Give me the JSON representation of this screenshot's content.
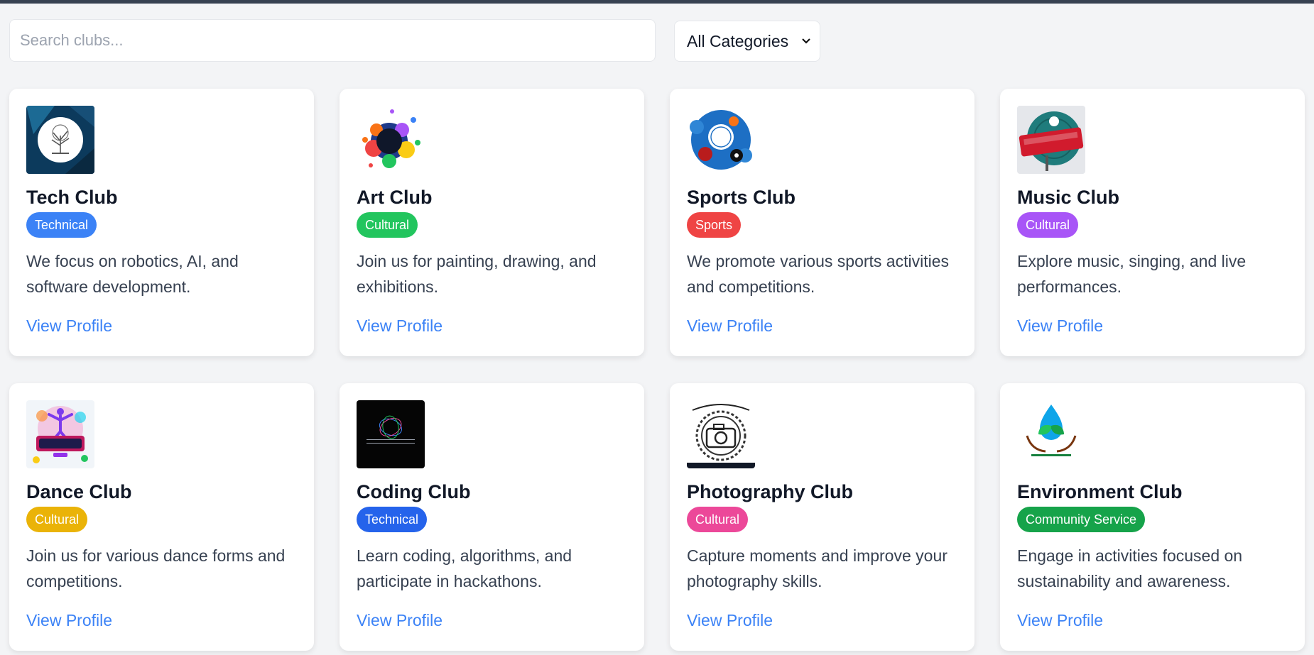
{
  "search": {
    "placeholder": "Search clubs..."
  },
  "filter": {
    "selected": "All Categories"
  },
  "clubs": [
    {
      "name": "Tech Club",
      "category": "Technical",
      "badge_color": "#3b82f6",
      "description": "We focus on robotics, AI, and software development.",
      "link": "View Profile",
      "logo_icon": "tree-icon"
    },
    {
      "name": "Art Club",
      "category": "Cultural",
      "badge_color": "#22c55e",
      "description": "Join us for painting, drawing, and exhibitions.",
      "link": "View Profile",
      "logo_icon": "paint-splash-icon"
    },
    {
      "name": "Sports Club",
      "category": "Sports",
      "badge_color": "#ef4444",
      "description": "We promote various sports activities and competitions.",
      "link": "View Profile",
      "logo_icon": "sports-ball-icon"
    },
    {
      "name": "Music Club",
      "category": "Cultural",
      "badge_color": "#a855f7",
      "description": "Explore music, singing, and live performances.",
      "link": "View Profile",
      "logo_icon": "music-record-icon"
    },
    {
      "name": "Dance Club",
      "category": "Cultural",
      "badge_color": "#eab308",
      "description": "Join us for various dance forms and competitions.",
      "link": "View Profile",
      "logo_icon": "dancer-icon"
    },
    {
      "name": "Coding Club",
      "category": "Technical",
      "badge_color": "#2563eb",
      "description": "Learn coding, algorithms, and participate in hackathons.",
      "link": "View Profile",
      "logo_icon": "code-icon"
    },
    {
      "name": "Photography Club",
      "category": "Cultural",
      "badge_color": "#ec4899",
      "description": "Capture moments and improve your photography skills.",
      "link": "View Profile",
      "logo_icon": "camera-icon"
    },
    {
      "name": "Environment Club",
      "category": "Community Service",
      "badge_color": "#16a34a",
      "description": "Engage in activities focused on sustainability and awareness.",
      "link": "View Profile",
      "logo_icon": "leaf-drop-icon"
    }
  ]
}
